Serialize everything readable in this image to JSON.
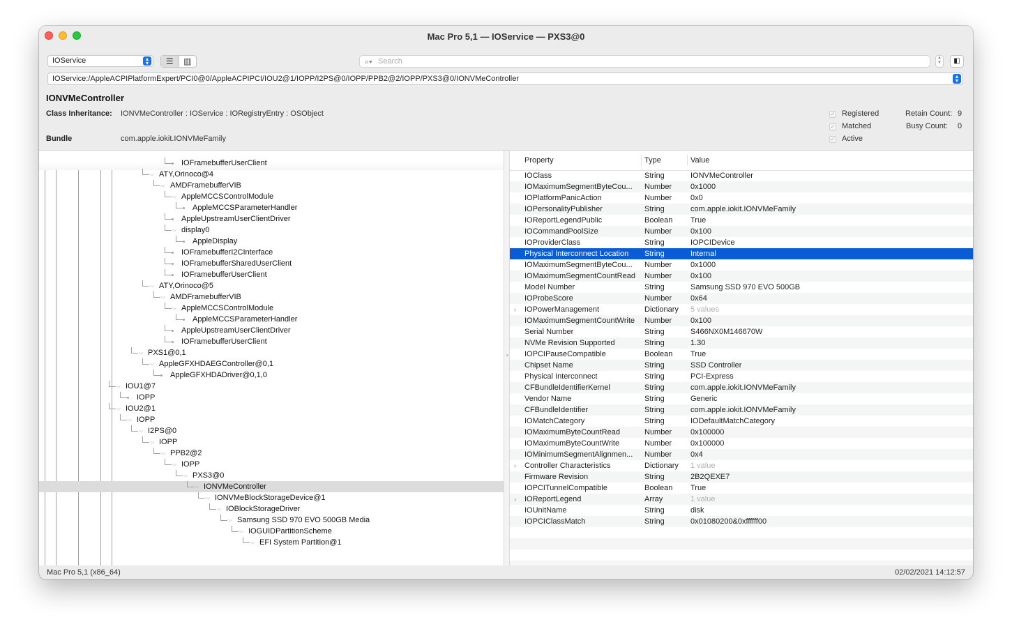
{
  "window": {
    "title": "Mac Pro 5,1 — IOService — PXS3@0"
  },
  "toolbar": {
    "plane": "IOService",
    "search_placeholder": "Search"
  },
  "path": "IOService:/AppleACPIPlatformExpert/PCI0@0/AppleACPIPCI/IOU2@1/IOPP/I2PS@0/IOPP/PPB2@2/IOPP/PXS3@0/IONVMeController",
  "info": {
    "class_name": "IONVMeController",
    "inheritance_label": "Class Inheritance:",
    "inheritance": "IONVMeController : IOService : IORegistryEntry : OSObject",
    "bundle_label": "Bundle",
    "bundle": "com.apple.iokit.IONVMeFamily",
    "flags": {
      "registered": "Registered",
      "matched": "Matched",
      "active": "Active"
    },
    "retain_label": "Retain Count:",
    "retain": "9",
    "busy_label": "Busy Count:",
    "busy": "0"
  },
  "tree": [
    {
      "label": "IOFramebufferUserClient",
      "depth": 9,
      "expanded": false
    },
    {
      "label": "ATY,Orinoco@4",
      "depth": 7,
      "expanded": true
    },
    {
      "label": "AMDFramebufferVIB",
      "depth": 8,
      "expanded": true
    },
    {
      "label": "AppleMCCSControlModule",
      "depth": 9,
      "expanded": true
    },
    {
      "label": "AppleMCCSParameterHandler",
      "depth": 10,
      "expanded": false
    },
    {
      "label": "AppleUpstreamUserClientDriver",
      "depth": 9,
      "expanded": false
    },
    {
      "label": "display0",
      "depth": 9,
      "expanded": true
    },
    {
      "label": "AppleDisplay",
      "depth": 10,
      "expanded": false
    },
    {
      "label": "IOFramebufferI2CInterface",
      "depth": 9,
      "expanded": false
    },
    {
      "label": "IOFramebufferSharedUserClient",
      "depth": 9,
      "expanded": false
    },
    {
      "label": "IOFramebufferUserClient",
      "depth": 9,
      "expanded": false
    },
    {
      "label": "ATY,Orinoco@5",
      "depth": 7,
      "expanded": true
    },
    {
      "label": "AMDFramebufferVIB",
      "depth": 8,
      "expanded": true
    },
    {
      "label": "AppleMCCSControlModule",
      "depth": 9,
      "expanded": true
    },
    {
      "label": "AppleMCCSParameterHandler",
      "depth": 10,
      "expanded": false
    },
    {
      "label": "AppleUpstreamUserClientDriver",
      "depth": 9,
      "expanded": false
    },
    {
      "label": "IOFramebufferUserClient",
      "depth": 9,
      "expanded": false
    },
    {
      "label": "PXS1@0,1",
      "depth": 6,
      "expanded": true
    },
    {
      "label": "AppleGFXHDAEGController@0,1",
      "depth": 7,
      "expanded": true
    },
    {
      "label": "AppleGFXHDADriver@0,1,0",
      "depth": 8,
      "expanded": false
    },
    {
      "label": "IOU1@7",
      "depth": 4,
      "expanded": true
    },
    {
      "label": "IOPP",
      "depth": 5,
      "expanded": false
    },
    {
      "label": "IOU2@1",
      "depth": 4,
      "expanded": true
    },
    {
      "label": "IOPP",
      "depth": 5,
      "expanded": true
    },
    {
      "label": "I2PS@0",
      "depth": 6,
      "expanded": true
    },
    {
      "label": "IOPP",
      "depth": 7,
      "expanded": true
    },
    {
      "label": "PPB2@2",
      "depth": 8,
      "expanded": true
    },
    {
      "label": "IOPP",
      "depth": 9,
      "expanded": true
    },
    {
      "label": "PXS3@0",
      "depth": 10,
      "expanded": true
    },
    {
      "label": "IONVMeController",
      "depth": 11,
      "expanded": true,
      "selected": true
    },
    {
      "label": "IONVMeBlockStorageDevice@1",
      "depth": 12,
      "expanded": true
    },
    {
      "label": "IOBlockStorageDriver",
      "depth": 13,
      "expanded": true
    },
    {
      "label": "Samsung SSD 970 EVO 500GB Media",
      "depth": 14,
      "expanded": true
    },
    {
      "label": "IOGUIDPartitionScheme",
      "depth": 15,
      "expanded": true
    },
    {
      "label": "EFI System Partition@1",
      "depth": 16,
      "expanded": true
    }
  ],
  "props_header": {
    "property": "Property",
    "type": "Type",
    "value": "Value"
  },
  "properties": [
    {
      "k": "IOClass",
      "t": "String",
      "v": "IONVMeController"
    },
    {
      "k": "IOMaximumSegmentByteCou...",
      "t": "Number",
      "v": "0x1000"
    },
    {
      "k": "IOPlatformPanicAction",
      "t": "Number",
      "v": "0x0"
    },
    {
      "k": "IOPersonalityPublisher",
      "t": "String",
      "v": "com.apple.iokit.IONVMeFamily"
    },
    {
      "k": "IOReportLegendPublic",
      "t": "Boolean",
      "v": "True"
    },
    {
      "k": "IOCommandPoolSize",
      "t": "Number",
      "v": "0x100"
    },
    {
      "k": "IOProviderClass",
      "t": "String",
      "v": "IOPCIDevice"
    },
    {
      "k": "Physical Interconnect Location",
      "t": "String",
      "v": "Internal",
      "selected": true
    },
    {
      "k": "IOMaximumSegmentByteCou...",
      "t": "Number",
      "v": "0x1000"
    },
    {
      "k": "IOMaximumSegmentCountRead",
      "t": "Number",
      "v": "0x100"
    },
    {
      "k": "Model Number",
      "t": "String",
      "v": "Samsung SSD 970 EVO 500GB"
    },
    {
      "k": "IOProbeScore",
      "t": "Number",
      "v": "0x64"
    },
    {
      "k": "IOPowerManagement",
      "t": "Dictionary",
      "v": "5 values",
      "muted": true,
      "expandable": true
    },
    {
      "k": "IOMaximumSegmentCountWrite",
      "t": "Number",
      "v": "0x100"
    },
    {
      "k": "Serial Number",
      "t": "String",
      "v": "S466NX0M146670W"
    },
    {
      "k": "NVMe Revision Supported",
      "t": "String",
      "v": "1.30"
    },
    {
      "k": "IOPCIPauseCompatible",
      "t": "Boolean",
      "v": "True"
    },
    {
      "k": "Chipset Name",
      "t": "String",
      "v": "SSD Controller"
    },
    {
      "k": "Physical Interconnect",
      "t": "String",
      "v": "PCI-Express"
    },
    {
      "k": "CFBundleIdentifierKernel",
      "t": "String",
      "v": "com.apple.iokit.IONVMeFamily"
    },
    {
      "k": "Vendor Name",
      "t": "String",
      "v": "Generic"
    },
    {
      "k": "CFBundleIdentifier",
      "t": "String",
      "v": "com.apple.iokit.IONVMeFamily"
    },
    {
      "k": "IOMatchCategory",
      "t": "String",
      "v": "IODefaultMatchCategory"
    },
    {
      "k": "IOMaximumByteCountRead",
      "t": "Number",
      "v": "0x100000"
    },
    {
      "k": "IOMaximumByteCountWrite",
      "t": "Number",
      "v": "0x100000"
    },
    {
      "k": "IOMinimumSegmentAlignmen...",
      "t": "Number",
      "v": "0x4"
    },
    {
      "k": "Controller Characteristics",
      "t": "Dictionary",
      "v": "1 value",
      "muted": true,
      "expandable": true
    },
    {
      "k": "Firmware Revision",
      "t": "String",
      "v": "2B2QEXE7"
    },
    {
      "k": "IOPCITunnelCompatible",
      "t": "Boolean",
      "v": "True"
    },
    {
      "k": "IOReportLegend",
      "t": "Array",
      "v": "1 value",
      "muted": true,
      "expandable": true
    },
    {
      "k": "IOUnitName",
      "t": "String",
      "v": "disk"
    },
    {
      "k": "IOPCIClassMatch",
      "t": "String",
      "v": "0x01080200&0xffffff00"
    }
  ],
  "status": {
    "machine": "Mac Pro 5,1 (x86_64)",
    "timestamp": "02/02/2021 14:12:57"
  },
  "colors": {
    "selection": "#0a5bd6",
    "accent": "#1b73e8"
  }
}
